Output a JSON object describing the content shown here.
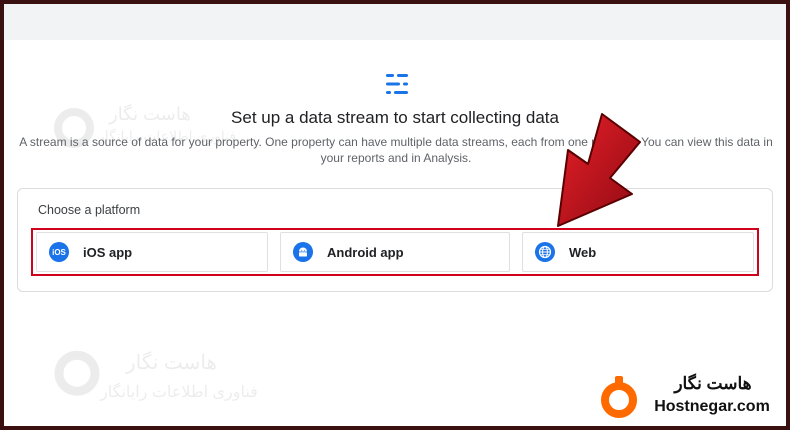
{
  "header": {
    "title": "Set up a data stream to start collecting data",
    "description": "A stream is a source of data for your property. One property can have multiple data streams, each from one platform. You can view this data in your reports and in Analysis."
  },
  "platform_card": {
    "label": "Choose a platform",
    "options": [
      {
        "label": "iOS app",
        "icon": "ios-icon",
        "icon_text": "iOS"
      },
      {
        "label": "Android app",
        "icon": "android-icon"
      },
      {
        "label": "Web",
        "icon": "globe-icon"
      }
    ]
  },
  "watermark": {
    "fa_name": "هاست نگار",
    "fa_tagline": "فناوری اطلاعات رایانگار"
  },
  "brand": {
    "fa_name": "هاست نگار",
    "en_name": "Hostnegar.com",
    "accent": "#ff6a00"
  },
  "colors": {
    "accent_blue": "#1a73e8",
    "highlight_red": "#d0021b",
    "arrow_red": "#c8102e"
  }
}
